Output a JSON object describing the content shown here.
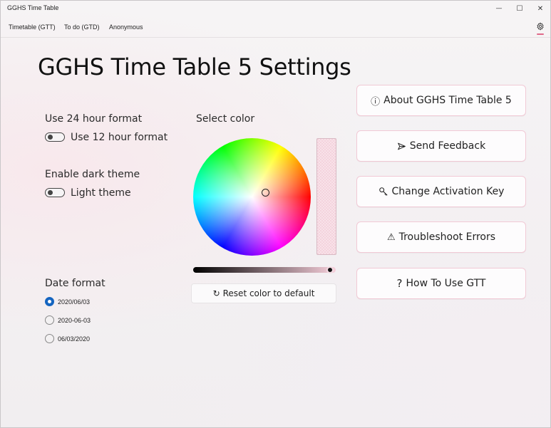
{
  "window": {
    "title": "GGHS Time Table",
    "minimize_glyph": "—",
    "maximize_glyph": "☐",
    "close_glyph": "✕"
  },
  "nav": {
    "items": [
      {
        "label": "Timetable (GTT)"
      },
      {
        "label": "To do (GTD)"
      },
      {
        "label": "Anonymous"
      }
    ],
    "settings_icon": "gear-icon",
    "accent": "#e06a8a"
  },
  "page": {
    "title": "GGHS Time Table 5 Settings"
  },
  "time_format": {
    "header": "Use 24 hour format",
    "toggle_text": "Use 12 hour format",
    "is_on": false
  },
  "theme": {
    "header": "Enable dark theme",
    "toggle_text": "Light theme",
    "is_on": false
  },
  "date_format": {
    "header": "Date format",
    "options": [
      {
        "label": "2020/06/03",
        "checked": true
      },
      {
        "label": "2020-06-03",
        "checked": false
      },
      {
        "label": "06/03/2020",
        "checked": false
      }
    ],
    "selected_color": "#1565c0"
  },
  "color_picker": {
    "header": "Select color",
    "selected_color": "#f4d3dd",
    "value_fraction": 0.96,
    "reset_label": "Reset color to default",
    "reset_icon": "refresh-icon"
  },
  "actions": [
    {
      "label": "About GGHS Time Table 5",
      "icon": "info-icon",
      "glyph": "ⓘ"
    },
    {
      "label": "Send Feedback",
      "icon": "send-icon",
      "glyph": "➢"
    },
    {
      "label": "Change Activation Key",
      "icon": "key-icon",
      "glyph": "⚷"
    },
    {
      "label": "Troubleshoot Errors",
      "icon": "warning-icon",
      "glyph": "⚠"
    },
    {
      "label": "How To Use GTT",
      "icon": "question-icon",
      "glyph": "?"
    }
  ]
}
